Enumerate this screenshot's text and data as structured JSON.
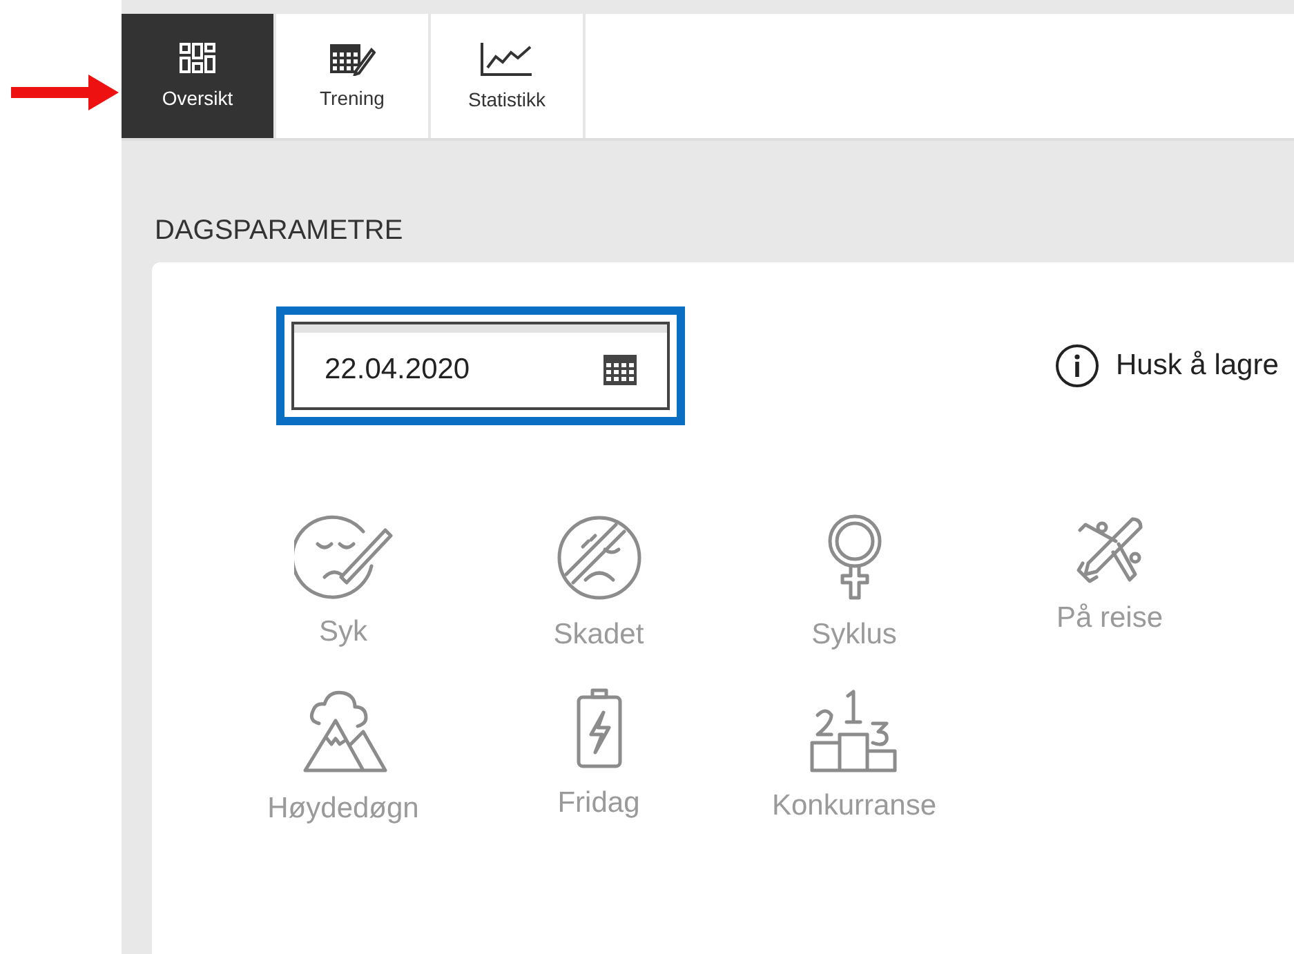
{
  "tabs": [
    {
      "label": "Oversikt",
      "kind": "overview",
      "selected": true
    },
    {
      "label": "Trening",
      "kind": "training",
      "selected": false
    },
    {
      "label": "Statistikk",
      "kind": "stats",
      "selected": false
    }
  ],
  "section_title": "DAGSPARAMETRE",
  "date_field": {
    "value": "22.04.2020",
    "highlighted": true
  },
  "notice": "Husk å lagre",
  "parameters": [
    {
      "label": "Syk",
      "kind": "sick"
    },
    {
      "label": "Skadet",
      "kind": "injured"
    },
    {
      "label": "Syklus",
      "kind": "cycle"
    },
    {
      "label": "På reise",
      "kind": "travel"
    },
    {
      "label": "Høydedøgn",
      "kind": "altitude"
    },
    {
      "label": "Fridag",
      "kind": "rest"
    },
    {
      "label": "Konkurranse",
      "kind": "competition"
    }
  ]
}
